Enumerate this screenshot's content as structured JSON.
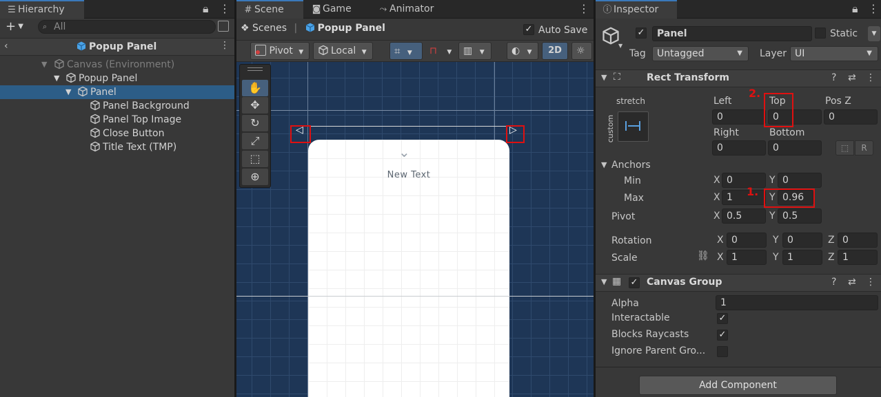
{
  "hierarchy": {
    "tab": "Hierarchy",
    "search_placeholder": "All",
    "title": "Popup Panel",
    "items": [
      {
        "label": "Canvas (Environment)"
      },
      {
        "label": "Popup Panel"
      },
      {
        "label": "Panel"
      },
      {
        "label": "Panel Background"
      },
      {
        "label": "Panel Top Image"
      },
      {
        "label": "Close Button"
      },
      {
        "label": "Title Text (TMP)"
      }
    ]
  },
  "scene": {
    "tabs": [
      "Scene",
      "Game",
      "Animator"
    ],
    "breadcrumb_root": "Scenes",
    "breadcrumb_current": "Popup Panel",
    "auto_save": "Auto Save",
    "toolbar": {
      "pivot": "Pivot",
      "local": "Local",
      "mode_2d": "2D"
    },
    "canvas_text": "New Text"
  },
  "inspector": {
    "tab": "Inspector",
    "object_name": "Panel",
    "static_label": "Static",
    "tag_label": "Tag",
    "tag_value": "Untagged",
    "layer_label": "Layer",
    "layer_value": "UI",
    "rect_transform": {
      "title": "Rect Transform",
      "stretch_label": "stretch",
      "custom_label": "custom",
      "labels": {
        "left": "Left",
        "top": "Top",
        "posz": "Pos Z",
        "right": "Right",
        "bottom": "Bottom"
      },
      "values": {
        "left": "0",
        "top": "0",
        "posz": "0",
        "right": "0",
        "bottom": "0"
      },
      "anchors_label": "Anchors",
      "min_label": "Min",
      "max_label": "Max",
      "pivot_label": "Pivot",
      "anchor_min": {
        "x": "0",
        "y": "0"
      },
      "anchor_max": {
        "x": "1",
        "y": "0.96"
      },
      "pivot": {
        "x": "0.5",
        "y": "0.5"
      },
      "rotation_label": "Rotation",
      "rotation": {
        "x": "0",
        "y": "0",
        "z": "0"
      },
      "scale_label": "Scale",
      "scale": {
        "x": "1",
        "y": "1",
        "z": "1"
      }
    },
    "canvas_group": {
      "title": "Canvas Group",
      "alpha_label": "Alpha",
      "alpha_value": "1",
      "interactable_label": "Interactable",
      "blocks_label": "Blocks Raycasts",
      "ignore_label": "Ignore Parent Gro..."
    },
    "add_component": "Add Component"
  },
  "annotations": {
    "step1": "1.",
    "step2": "2."
  },
  "colors": {
    "selection": "#2c5d87",
    "accent": "#3a79bb",
    "highlight": "#e01010",
    "scene_bg": "#1e3656"
  }
}
